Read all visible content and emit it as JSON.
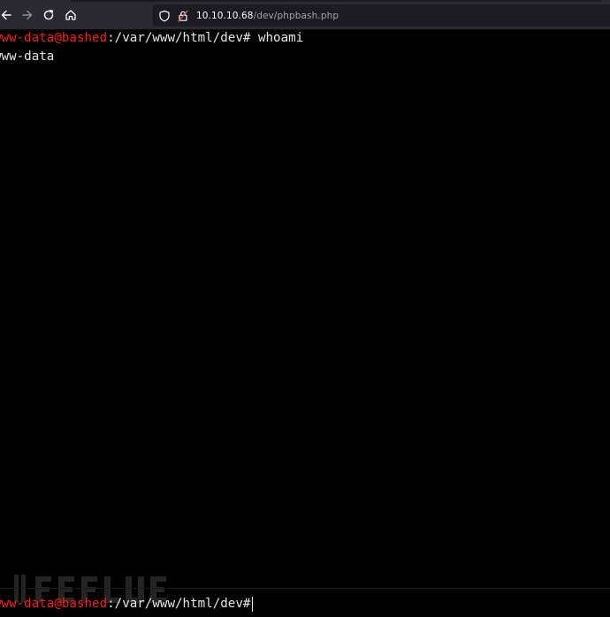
{
  "browser": {
    "url_host": "10.10.10.68",
    "url_path": "/dev/phpbash.php",
    "icons": {
      "back": "arrow-left-icon",
      "forward": "arrow-right-icon",
      "reload": "reload-icon",
      "home": "home-icon",
      "shield": "tracking-shield-icon",
      "lock": "insecure-lock-icon"
    }
  },
  "terminal": {
    "history": [
      {
        "user_host": "www-data@bashed",
        "path": ":/var/www/html/dev#",
        "command": " whoami"
      }
    ],
    "output": "www-data",
    "input": {
      "user_host": "www-data@bashed",
      "path": ":/var/www/html/dev#",
      "value": ""
    }
  },
  "colors": {
    "background": "#000000",
    "prompt_user": "#ff1a1a",
    "text": "#e6e6e6",
    "toolbar": "#2b2a33",
    "urlbar": "#1c1b22"
  }
}
